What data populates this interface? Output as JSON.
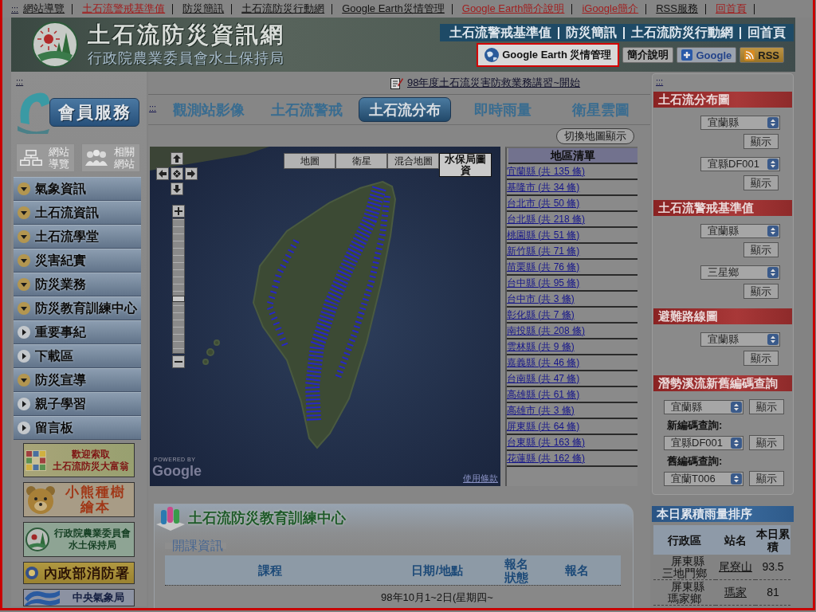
{
  "top_bar": {
    "skip_link": ":::",
    "links": [
      {
        "label": "網站導覽",
        "color": "#141414"
      },
      {
        "label": "土石流警戒基準值",
        "color": "#a02020"
      },
      {
        "label": "防災簡訊",
        "color": "#141414"
      },
      {
        "label": "土石流防災行動網",
        "color": "#141414"
      },
      {
        "label": "Google Earth災情管理",
        "color": "#141414"
      },
      {
        "label": "Google Earth簡介說明",
        "color": "#a02020"
      },
      {
        "label": "iGoogle簡介",
        "color": "#a02020"
      },
      {
        "label": "RSS服務",
        "color": "#141414"
      },
      {
        "label": "回首頁",
        "color": "#a02020"
      }
    ]
  },
  "header": {
    "title": "土石流防災資訊網",
    "subtitle": "行政院農業委員會水土保持局",
    "nav_links": [
      "土石流警戒基準值",
      "防災簡訊",
      "土石流防災行動網",
      "回首頁"
    ],
    "buttons": [
      {
        "kind": "google-earth",
        "label": "Google Earth 災情管理",
        "highlighted": true
      },
      {
        "kind": "plain",
        "label": "簡介說明",
        "highlighted": false
      },
      {
        "kind": "google",
        "label": "Google",
        "highlighted": false
      },
      {
        "kind": "rss",
        "label": "RSS",
        "highlighted": false
      }
    ]
  },
  "left_sidebar": {
    "skip_link": ":::",
    "member_button": "會員服務",
    "quick_links": [
      {
        "kind": "sitemap",
        "label": "網站導覽"
      },
      {
        "kind": "related",
        "label": "相關網站"
      }
    ],
    "menu": [
      {
        "label": "氣象資訊",
        "kind": "dropdown"
      },
      {
        "label": "土石流資訊",
        "kind": "dropdown"
      },
      {
        "label": "土石流學堂",
        "kind": "dropdown"
      },
      {
        "label": "災害紀實",
        "kind": "dropdown"
      },
      {
        "label": "防災業務",
        "kind": "dropdown"
      },
      {
        "label": "防災教育訓練中心",
        "kind": "dropdown"
      },
      {
        "label": "重要事紀",
        "kind": "link"
      },
      {
        "label": "下載區",
        "kind": "link"
      },
      {
        "label": "防災宣導",
        "kind": "dropdown"
      },
      {
        "label": "親子學習",
        "kind": "link"
      },
      {
        "label": "留言板",
        "kind": "link"
      }
    ],
    "banners": [
      {
        "kind": "game",
        "lines": [
          "歡迎索取",
          "土石流防災大富翁"
        ]
      },
      {
        "kind": "bear",
        "lines": [
          "小熊種樹",
          "繪本"
        ]
      },
      {
        "kind": "agency",
        "lines": [
          "行政院農業委員會",
          "水土保持局"
        ]
      },
      {
        "kind": "fire",
        "lines": [
          "內政部消防署"
        ]
      },
      {
        "kind": "weather",
        "lines": [
          "中央氣象局"
        ]
      }
    ]
  },
  "center": {
    "marquee": "98年度土石流災害防救業務講習~開始",
    "skip_link": ":::",
    "tabs": [
      {
        "label": "觀測站影像",
        "selected": false
      },
      {
        "label": "土石流警戒",
        "selected": false
      },
      {
        "label": "土石流分布",
        "selected": true
      },
      {
        "label": "即時雨量",
        "selected": false
      },
      {
        "label": "衛星雲圖",
        "selected": false
      }
    ],
    "switch_button": "切換地圖顯示",
    "map": {
      "types": [
        {
          "label": "地圖",
          "selected": false
        },
        {
          "label": "衛星",
          "selected": false
        },
        {
          "label": "混合地圖",
          "selected": false
        },
        {
          "label": "水保局圖資",
          "selected": true
        }
      ],
      "zoom_slider": {
        "level": 0.4
      },
      "powered_by": "POWERED BY",
      "logo": "Google",
      "terms_link": "使用條款"
    },
    "region_list": {
      "title": "地區清單",
      "items": [
        "宜蘭縣 (共 135 條)",
        "基隆市 (共 34 條)",
        "台北市 (共 50 條)",
        "台北縣 (共 218 條)",
        "桃園縣 (共 51 條)",
        "新竹縣 (共 71 條)",
        "苗栗縣 (共 76 條)",
        "台中縣 (共 95 條)",
        "台中市 (共 3 條)",
        "彰化縣 (共 7 條)",
        "南投縣 (共 208 條)",
        "雲林縣 (共 9 條)",
        "嘉義縣 (共 46 條)",
        "台南縣 (共 47 條)",
        "高雄縣 (共 61 條)",
        "高雄市 (共 3 條)",
        "屏東縣 (共 64 條)",
        "台東縣 (共 163 條)",
        "花蓮縣 (共 162 條)"
      ]
    },
    "training": {
      "title": "土石流防災教育訓練中心",
      "subtitle": "開課資訊",
      "columns": [
        "課程",
        "日期/地點",
        "報名狀態",
        "報名"
      ],
      "rows": [
        {
          "date": "98年10月1~2日(星期四~"
        }
      ]
    }
  },
  "right_sidebar": {
    "skip_link": ":::",
    "sections": [
      {
        "title": "土石流分布圖",
        "rows": [
          {
            "kind": "select",
            "value": "宜蘭縣"
          },
          {
            "kind": "button",
            "label": "顯示"
          },
          {
            "kind": "select",
            "value": "宜縣DF001"
          },
          {
            "kind": "button",
            "label": "顯示"
          }
        ]
      },
      {
        "title": "土石流警戒基準值",
        "rows": [
          {
            "kind": "select",
            "value": "宜蘭縣"
          },
          {
            "kind": "button",
            "label": "顯示"
          },
          {
            "kind": "select",
            "value": "三星鄉"
          },
          {
            "kind": "button",
            "label": "顯示"
          }
        ]
      },
      {
        "title": "避難路線圖",
        "rows": [
          {
            "kind": "select",
            "value": "宜蘭縣"
          },
          {
            "kind": "button",
            "label": "顯示"
          }
        ]
      },
      {
        "title": "潛勢溪流新舊編碼查詢",
        "rows": [
          {
            "kind": "inline",
            "value": "宜蘭縣",
            "button": "顯示"
          },
          {
            "kind": "label",
            "label": "新編碼查詢:"
          },
          {
            "kind": "inline",
            "value": "宜縣DF001",
            "button": "顯示"
          },
          {
            "kind": "label",
            "label": "舊編碼查詢:"
          },
          {
            "kind": "inline",
            "value": "宜蘭T006",
            "button": "顯示"
          }
        ]
      }
    ],
    "rain_ranking": {
      "title": "本日累積雨量排序",
      "columns": [
        "行政區",
        "站名",
        "本日累積"
      ],
      "rows": [
        {
          "district": "屏東縣三地門鄉",
          "station": "尾寮山",
          "amount": "93.5"
        },
        {
          "district": "屏東縣瑪家鄉",
          "station": "瑪家",
          "amount": "81"
        }
      ]
    }
  }
}
